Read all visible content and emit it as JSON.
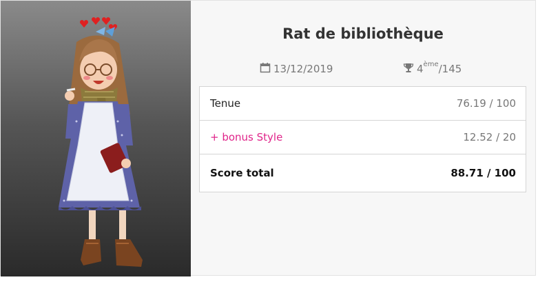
{
  "title": "Rat de bibliothèque",
  "date": "13/12/2019",
  "rank": {
    "position": "4",
    "suffix": "ème",
    "total": "/145"
  },
  "scores": [
    {
      "label": "Tenue",
      "value": "76.19 / 100"
    },
    {
      "label": "+ bonus Style",
      "value": "12.52 / 20"
    },
    {
      "label": "Score total",
      "value": "88.71 / 100"
    }
  ],
  "icons": {
    "date": "calendar-icon",
    "rank": "trophy-icon"
  },
  "colors": {
    "bonus": "#e0248a",
    "title": "#333333",
    "muted": "#777777"
  }
}
